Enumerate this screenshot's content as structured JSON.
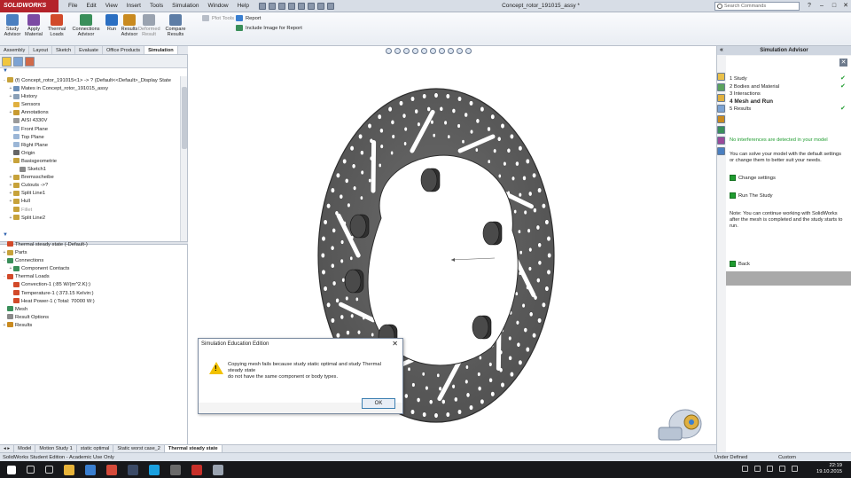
{
  "app": {
    "logo": "SOLIDWORKS",
    "doc_title": "Concept_rotor_191015_assy *"
  },
  "menu": [
    "File",
    "Edit",
    "View",
    "Insert",
    "Tools",
    "Simulation",
    "Window",
    "Help"
  ],
  "search": {
    "placeholder": "Search Commands"
  },
  "command_manager": {
    "buttons": [
      {
        "label": "Study Advisor",
        "color": "#4a7fc0"
      },
      {
        "label": "Apply Material",
        "color": "#7c4aa3"
      },
      {
        "label": "Thermal Loads",
        "color": "#d24a2a"
      },
      {
        "label": "Connections Advisor",
        "color": "#3a8f5a"
      },
      {
        "label": "Run",
        "color": "#2b6fc2"
      },
      {
        "label": "Results Advisor",
        "color": "#c98a1f"
      },
      {
        "label": "Deformed Result",
        "color": "#9aa3b0",
        "disabled": true
      },
      {
        "label": "Compare Results",
        "color": "#5d7da6"
      }
    ],
    "plot_tools": "Plot Tools",
    "report": "Report",
    "include_image": "Include Image for Report"
  },
  "cm_tabs": [
    "Assembly",
    "Layout",
    "Sketch",
    "Evaluate",
    "Office Products",
    "Simulation"
  ],
  "active_cm_tab": "Simulation",
  "feature_tree": [
    {
      "label": "(f) Concept_rotor_191015<1> -> ? (Default<<Default>_Display State",
      "color": "#c7a23a",
      "exp": "-"
    },
    {
      "label": "Mates in Concept_rotor_191015_assy",
      "color": "#6b8fb8",
      "exp": "+",
      "indent": 1
    },
    {
      "label": "History",
      "color": "#8aa0b8",
      "exp": "+",
      "indent": 1
    },
    {
      "label": "Sensors",
      "color": "#e0b040",
      "exp": "",
      "indent": 1
    },
    {
      "label": "Annotations",
      "color": "#c89a30",
      "exp": "+",
      "indent": 1
    },
    {
      "label": "AISI 4330V",
      "color": "#9a9a9a",
      "exp": "",
      "indent": 1
    },
    {
      "label": "Front Plane",
      "color": "#9bb6d6",
      "exp": "",
      "indent": 1
    },
    {
      "label": "Top Plane",
      "color": "#9bb6d6",
      "exp": "",
      "indent": 1
    },
    {
      "label": "Right Plane",
      "color": "#9bb6d6",
      "exp": "",
      "indent": 1
    },
    {
      "label": "Origin",
      "color": "#666666",
      "exp": "",
      "indent": 1
    },
    {
      "label": "Basisgeometrie",
      "color": "#c7a23a",
      "exp": "-",
      "indent": 1
    },
    {
      "label": "Sketch1",
      "color": "#8a8a8a",
      "exp": "",
      "indent": 2
    },
    {
      "label": "Bremsscheibe",
      "color": "#c7a23a",
      "exp": "+",
      "indent": 1
    },
    {
      "label": "Cutouts ->?",
      "color": "#c7a23a",
      "exp": "+",
      "indent": 1
    },
    {
      "label": "Split Line1",
      "color": "#c7a23a",
      "exp": "+",
      "indent": 1
    },
    {
      "label": "Hull",
      "color": "#c7a23a",
      "exp": "+",
      "indent": 1
    },
    {
      "label": "Fillet",
      "color": "#c7a23a",
      "exp": "",
      "indent": 1,
      "gray": true
    },
    {
      "label": "Split Line2",
      "color": "#c7a23a",
      "exp": "+",
      "indent": 1
    }
  ],
  "sim_tree": [
    {
      "label": "Thermal steady state (-Default-)",
      "color": "#d24a2a",
      "exp": "",
      "indent": 0
    },
    {
      "label": "Parts",
      "color": "#c7a23a",
      "exp": "+",
      "indent": 0
    },
    {
      "label": "Connections",
      "color": "#3a8f5a",
      "exp": "-",
      "indent": 0
    },
    {
      "label": "Component Contacts",
      "color": "#3a8f5a",
      "exp": "+",
      "indent": 1
    },
    {
      "label": "Thermal Loads",
      "color": "#d24a2a",
      "exp": "-",
      "indent": 0
    },
    {
      "label": "Convection-1 (:85 W/(m^2.K):)",
      "color": "#d24a2a",
      "exp": "",
      "indent": 1
    },
    {
      "label": "Temperature-1 (:373.15 Kelvin:)",
      "color": "#d24a2a",
      "exp": "",
      "indent": 1
    },
    {
      "label": "Heat Power-1 (:Total: 70000 W:)",
      "color": "#d24a2a",
      "exp": "",
      "indent": 1
    },
    {
      "label": "Mesh",
      "color": "#3a8f5a",
      "exp": "",
      "indent": 0
    },
    {
      "label": "Result Options",
      "color": "#8a8a8a",
      "exp": "",
      "indent": 0
    },
    {
      "label": "Results",
      "color": "#c98a1f",
      "exp": "+",
      "indent": 0
    }
  ],
  "task_pane": {
    "title": "Simulation Advisor",
    "steps": [
      {
        "n": "1",
        "label": "Study",
        "done": true
      },
      {
        "n": "2",
        "label": "Bodies and Material",
        "done": true
      },
      {
        "n": "3",
        "label": "Interactions",
        "done": false
      },
      {
        "n": "4",
        "label": "Mesh and Run",
        "done": false,
        "current": true
      },
      {
        "n": "5",
        "label": "Results",
        "done": true
      }
    ],
    "no_interference": "No interferences are detected in your model",
    "solve_text": "You can solve your model with the default settings or change them to better suit your needs.",
    "change_settings": "Change settings",
    "run_study": "Run The Study",
    "note": "Note: You can continue working with SolidWorks after the mesh is completed and the study starts to run.",
    "back": "Back"
  },
  "dialog": {
    "title": "Simulation Education Edition",
    "message_1": "Copying mesh fails because study static optimal and study Thermal steady state",
    "message_2": "do not have the same component or body types.",
    "ok": "OK"
  },
  "bottom_tabs": [
    "Model",
    "Motion Study 1",
    "static optimal",
    "Static worst case_2",
    "Thermal steady state"
  ],
  "active_bottom_tab": "Thermal steady state",
  "status": {
    "left": "SolidWorks Student Edition - Academic Use Only",
    "defined": "Under Defined",
    "custom": "Custom"
  },
  "clock": {
    "time": "22:19",
    "date": "19.10.2015"
  },
  "taskbar_icons": [
    {
      "name": "windows-start-icon",
      "color": "#ffffff"
    },
    {
      "name": "search-icon",
      "color": "#cccccc"
    },
    {
      "name": "task-view-icon",
      "color": "#cccccc"
    },
    {
      "name": "explorer-icon",
      "color": "#e8b43a"
    },
    {
      "name": "store-icon",
      "color": "#3a7fd0"
    },
    {
      "name": "chrome-icon",
      "color": "#d44a3a"
    },
    {
      "name": "steam-icon",
      "color": "#3b4a66"
    },
    {
      "name": "skype-icon",
      "color": "#1aa0e0"
    },
    {
      "name": "app-icon",
      "color": "#6a6a6a"
    },
    {
      "name": "solidworks-icon",
      "color": "#c8302a"
    },
    {
      "name": "window-icon",
      "color": "#9aa3b0"
    }
  ]
}
